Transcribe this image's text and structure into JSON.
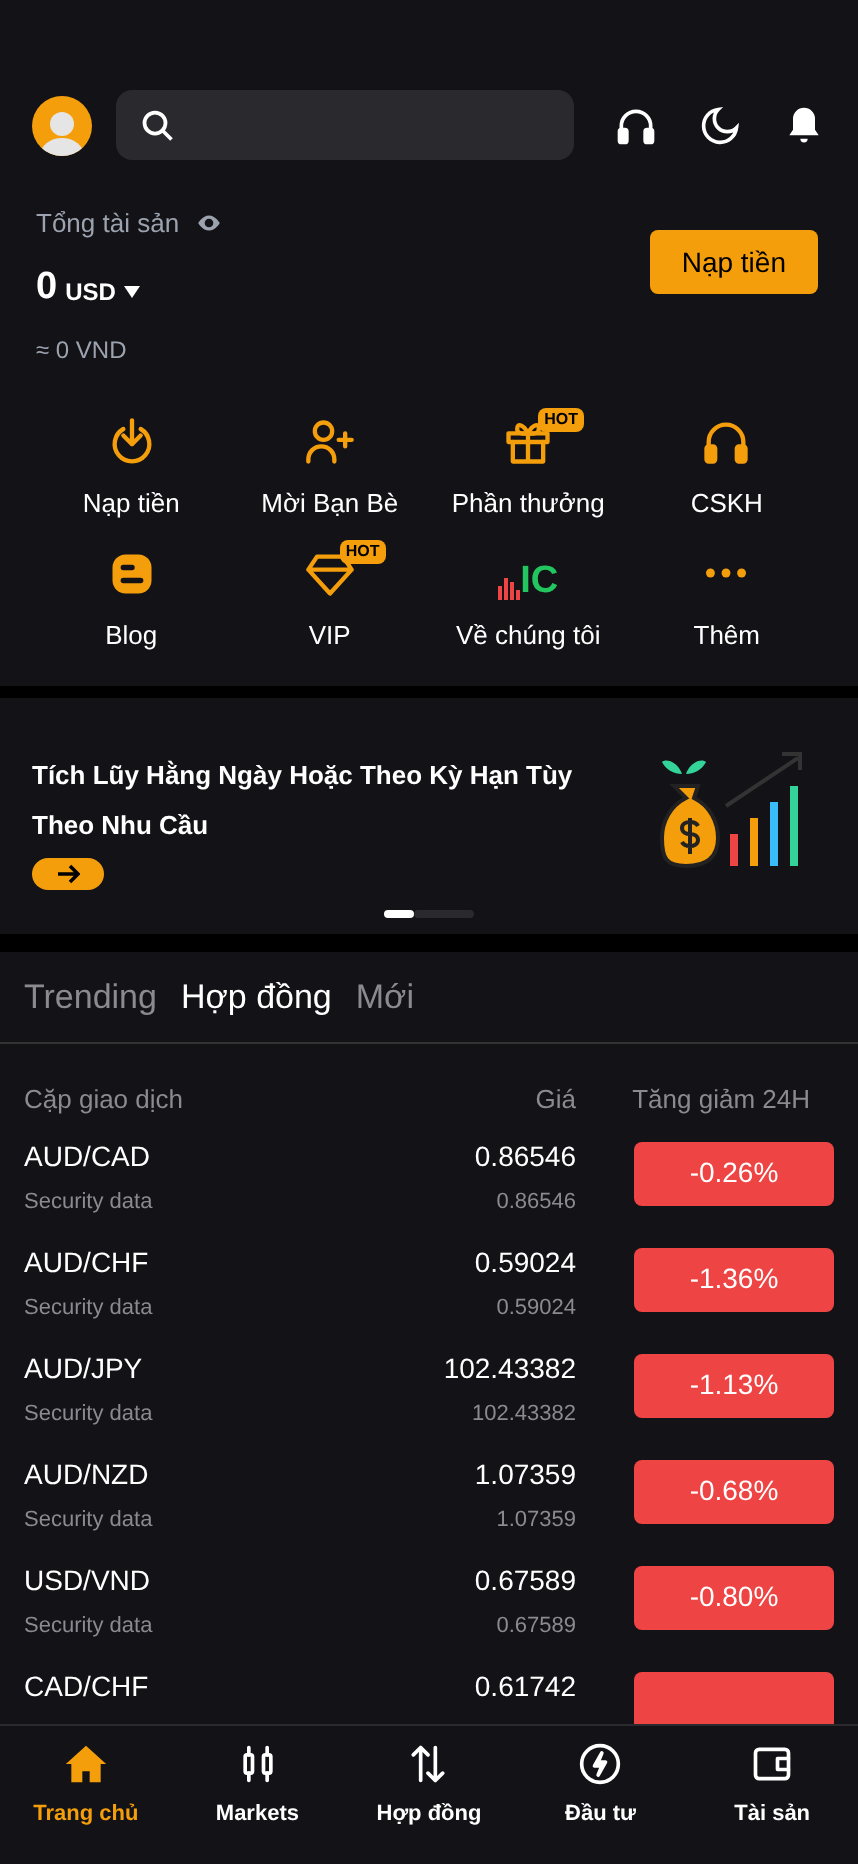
{
  "assets": {
    "label": "Tổng tài sản",
    "amount": "0",
    "currency": "USD",
    "approx": "≈ 0 VND",
    "deposit_button": "Nạp tiền"
  },
  "shortcuts": [
    {
      "kind": "download",
      "label": "Nạp tiền"
    },
    {
      "kind": "invite",
      "label": "Mời Bạn Bè"
    },
    {
      "kind": "gift",
      "label": "Phần thưởng",
      "badge": "HOT"
    },
    {
      "kind": "headset",
      "label": "CSKH"
    },
    {
      "kind": "blog",
      "label": "Blog"
    },
    {
      "kind": "diamond",
      "label": "VIP",
      "badge": "HOT"
    },
    {
      "kind": "logo",
      "label": "Về chúng tôi",
      "logo_text": "IC"
    },
    {
      "kind": "more",
      "label": "Thêm"
    }
  ],
  "banner": {
    "text": "Tích Lũy Hằng Ngày Hoặc Theo Kỳ Hạn Tùy Theo Nhu Cầu",
    "dots": [
      {
        "selected": true
      },
      {
        "selected": false
      }
    ]
  },
  "tabs": [
    {
      "label": "Trending",
      "selected": false
    },
    {
      "label": "Hợp đồng",
      "selected": true
    },
    {
      "label": "Mới",
      "selected": false
    }
  ],
  "table": {
    "columns": [
      "Cặp giao dịch",
      "Giá",
      "Tăng giảm 24H"
    ],
    "rows": [
      {
        "pair": "AUD/CAD",
        "sub": "Security data",
        "price": "0.86546",
        "price_sub": "0.86546",
        "change": "-0.26%"
      },
      {
        "pair": "AUD/CHF",
        "sub": "Security data",
        "price": "0.59024",
        "price_sub": "0.59024",
        "change": "-1.36%"
      },
      {
        "pair": "AUD/JPY",
        "sub": "Security data",
        "price": "102.43382",
        "price_sub": "102.43382",
        "change": "-1.13%"
      },
      {
        "pair": "AUD/NZD",
        "sub": "Security data",
        "price": "1.07359",
        "price_sub": "1.07359",
        "change": "-0.68%"
      },
      {
        "pair": "USD/VND",
        "sub": "Security data",
        "price": "0.67589",
        "price_sub": "0.67589",
        "change": "-0.80%"
      },
      {
        "pair": "CAD/CHF",
        "price": "0.61742"
      }
    ]
  },
  "nav": [
    {
      "kind": "home",
      "label": "Trang chủ",
      "selected": true
    },
    {
      "kind": "markets",
      "label": "Markets",
      "selected": false
    },
    {
      "kind": "contracts",
      "label": "Hợp đồng",
      "selected": false
    },
    {
      "kind": "invest",
      "label": "Đầu tư",
      "selected": false
    },
    {
      "kind": "wallet",
      "label": "Tài sản",
      "selected": false
    }
  ]
}
